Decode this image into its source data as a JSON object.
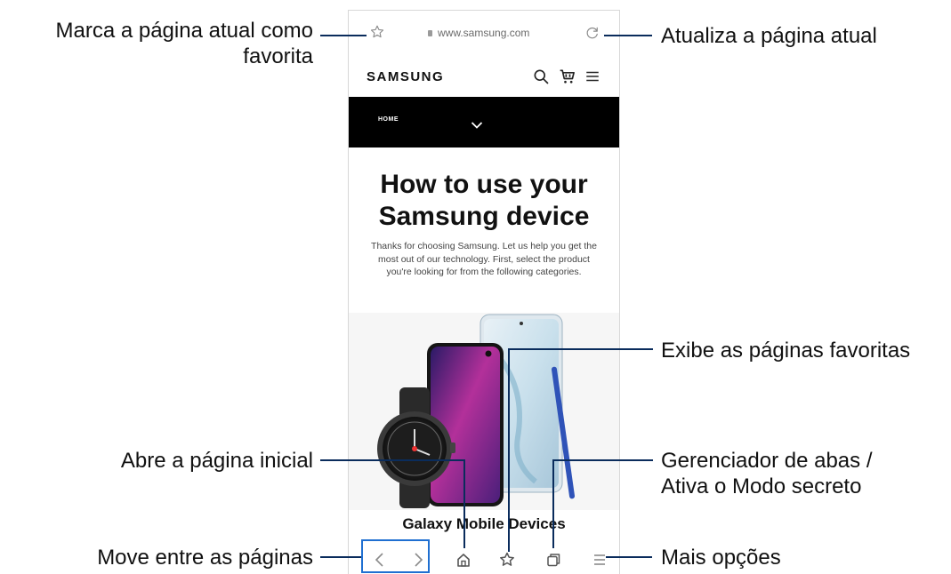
{
  "browser": {
    "url": "www.samsung.com",
    "icons": {
      "bookmark": "star-icon",
      "reload": "reload-icon",
      "lock": "lock-icon"
    }
  },
  "site": {
    "logo": "SAMSUNG",
    "nav_label": "HOME",
    "header_icons": [
      "search-icon",
      "cart-icon",
      "menu-icon"
    ],
    "headline_line1": "How to use your",
    "headline_line2": "Samsung device",
    "intro": "Thanks for choosing Samsung. Let us help you get the most out of our technology. First, select the product you're looking for from the following categories.",
    "section_title": "Galaxy Mobile Devices"
  },
  "toolbar": {
    "icons": [
      "back-icon",
      "forward-icon",
      "home-icon",
      "bookmarks-icon",
      "tabs-icon",
      "more-icon"
    ]
  },
  "callouts": {
    "bookmark_line1": "Marca a página atual como",
    "bookmark_line2": "favorita",
    "reload": "Atualiza a página atual",
    "bookmarks": "Exibe as páginas favoritas",
    "home": "Abre a página inicial",
    "tabs_line1": "Gerenciador de abas /",
    "tabs_line2": "Ativa o Modo secreto",
    "navigate": "Move entre as páginas",
    "more": "Mais opções"
  },
  "colors": {
    "leader_line": "#0a2c5c",
    "navbar": "#000000",
    "bracket": "#1f6fd1"
  }
}
